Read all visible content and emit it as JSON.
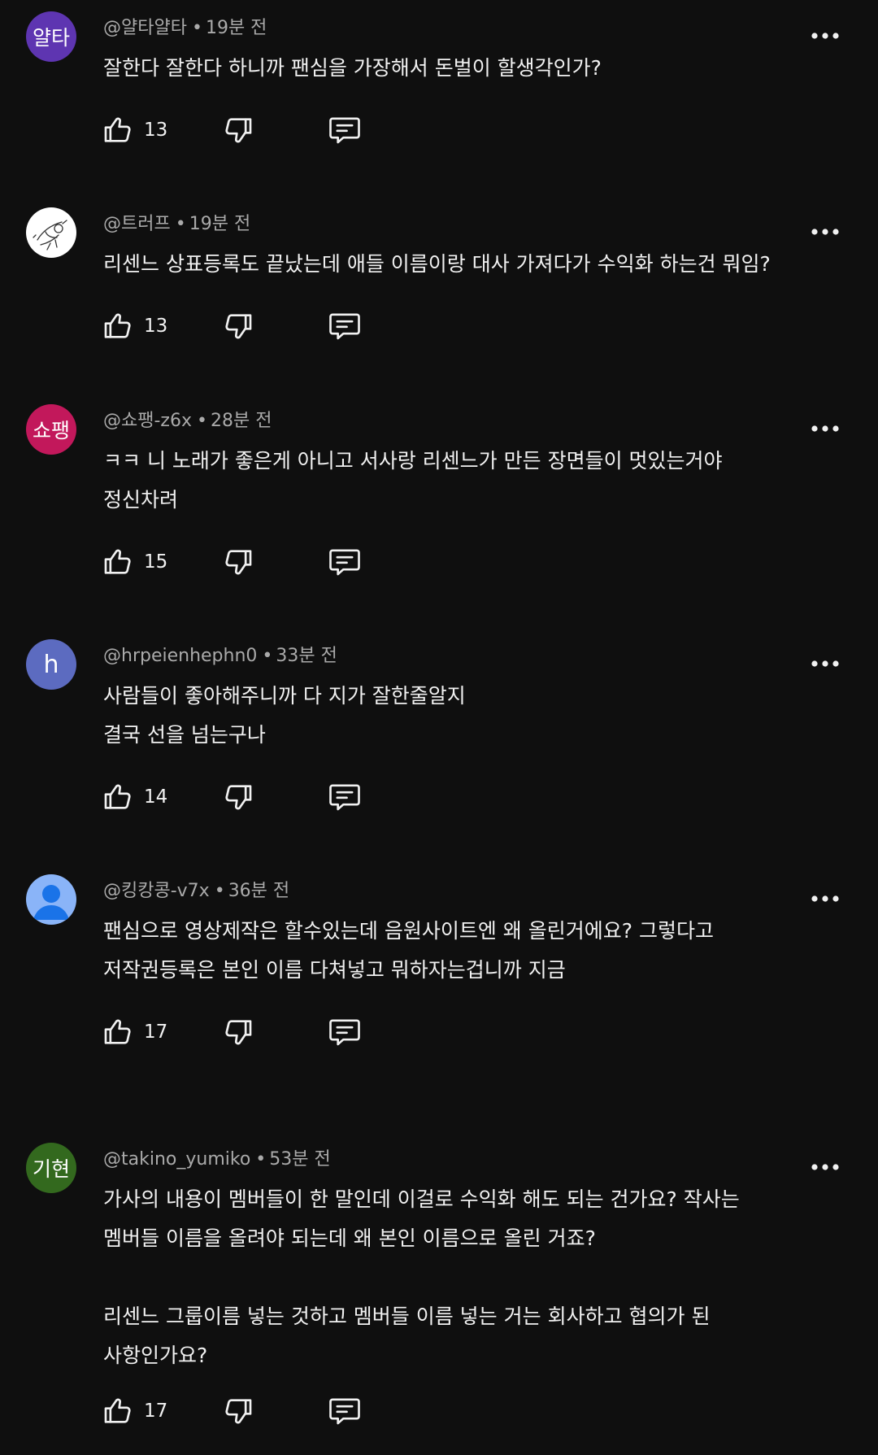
{
  "comments": [
    {
      "avatar_text": "얄타",
      "avatar_color": "#5e35b1",
      "author": "@얄타얄타",
      "time": "19분 전",
      "lines": [
        "잘한다 잘한다 하니까 팬심을 가장해서 돈벌이 할생각인가?"
      ],
      "likes": "13"
    },
    {
      "avatar_text": "",
      "avatar_color": "#ffffff",
      "author": "@트러프",
      "time": "19분 전",
      "lines": [
        "리센느 상표등록도 끝났는데 애들 이름이랑 대사 가져다가 수익화 하는건 뭐임?"
      ],
      "likes": "13"
    },
    {
      "avatar_text": "쇼팽",
      "avatar_color": "#c2185b",
      "author": "@쇼팽-z6x",
      "time": "28분 전",
      "lines": [
        "ㅋㅋ 니 노래가 좋은게 아니고 서사랑 리센느가 만든 장면들이 멋있는거야",
        "정신차려"
      ],
      "likes": "15"
    },
    {
      "avatar_text": "h",
      "avatar_color": "#5c6bc0",
      "author": "@hrpeienhephn0",
      "time": "33분 전",
      "lines": [
        "사람들이 좋아해주니까 다 지가 잘한줄알지",
        "결국 선을 넘는구나"
      ],
      "likes": "14"
    },
    {
      "avatar_text": "",
      "avatar_color": "#8ab4f8",
      "author": "@킹캉콩-v7x",
      "time": "36분 전",
      "lines": [
        "팬심으로 영상제작은 할수있는데 음원사이트엔 왜 올린거에요? 그렇다고",
        "저작권등록은 본인 이름 다쳐넣고 뭐하자는겁니까 지금"
      ],
      "likes": "17"
    },
    {
      "avatar_text": "기현",
      "avatar_color": "#33691e",
      "author": "@takino_yumiko",
      "time": "53분 전",
      "lines": [
        "가사의 내용이 멤버들이 한 말인데 이걸로 수익화 해도 되는 건가요? 작사는",
        "멤버들 이름을 올려야 되는데 왜 본인 이름으로 올린 거죠?",
        "",
        "리센느 그룹이름 넣는 것하고 멤버들 이름 넣는 거는 회사하고 협의가 된",
        "사항인가요?"
      ],
      "likes": "17"
    }
  ],
  "icons": {
    "more": "more-vert-icon",
    "like": "thumbs-up-icon",
    "dislike": "thumbs-down-icon",
    "reply": "comment-reply-icon",
    "default_avatar": "person-icon"
  }
}
